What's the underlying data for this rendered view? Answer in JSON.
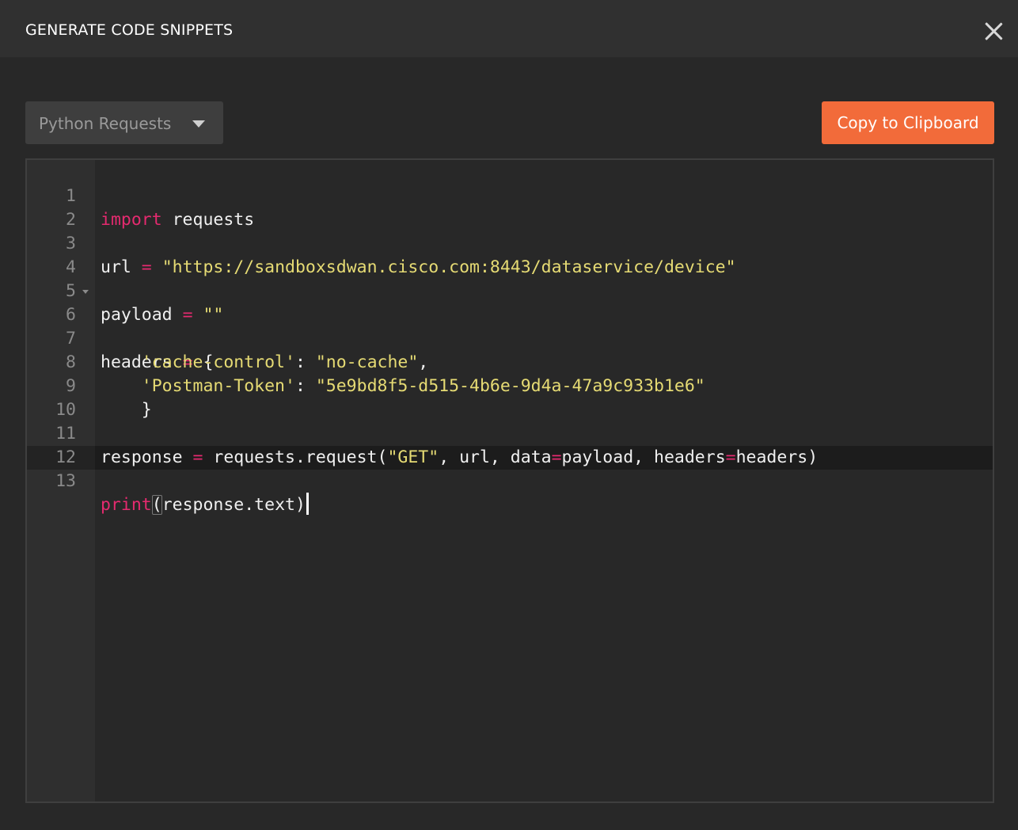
{
  "header": {
    "title": "GENERATE CODE SNIPPETS"
  },
  "toolbar": {
    "language": "Python Requests",
    "copy_label": "Copy to Clipboard"
  },
  "editor": {
    "line_numbers": [
      "1",
      "2",
      "3",
      "4",
      "5",
      "6",
      "7",
      "8",
      "9",
      "10",
      "11",
      "12",
      "13"
    ],
    "lines": {
      "l1": {
        "kw": "import",
        "rest": " requests"
      },
      "l3": {
        "name": "url",
        "eq": "=",
        "str": "\"https://sandboxsdwan.cisco.com:8443/dataservice/device\""
      },
      "l5": {
        "name": "payload",
        "eq": "=",
        "str": "\"\""
      },
      "l6": {
        "name": "headers",
        "eq": "=",
        "rest": " {"
      },
      "l7": {
        "indent": "    ",
        "key": "'cache-control'",
        "colon": ": ",
        "val": "\"no-cache\"",
        "tail": ","
      },
      "l8": {
        "indent": "    ",
        "key": "'Postman-Token'",
        "colon": ": ",
        "val": "\"5e9bd8f5-d515-4b6e-9d4a-47a9c933b1e6\""
      },
      "l9": {
        "text": "    }"
      },
      "l11": {
        "a": "response ",
        "eq": "=",
        "b": " requests.request(",
        "str": "\"GET\"",
        "c": ", url, data",
        "eq2": "=",
        "d": "payload, headers",
        "eq3": "=",
        "e": "headers)"
      },
      "l13": {
        "kw": "print",
        "open": "(",
        "mid": "response.text",
        "close": ")"
      }
    }
  },
  "colors": {
    "accent": "#f26b3a",
    "keyword": "#e52a6f",
    "string": "#e6db74",
    "background": "#282828"
  }
}
